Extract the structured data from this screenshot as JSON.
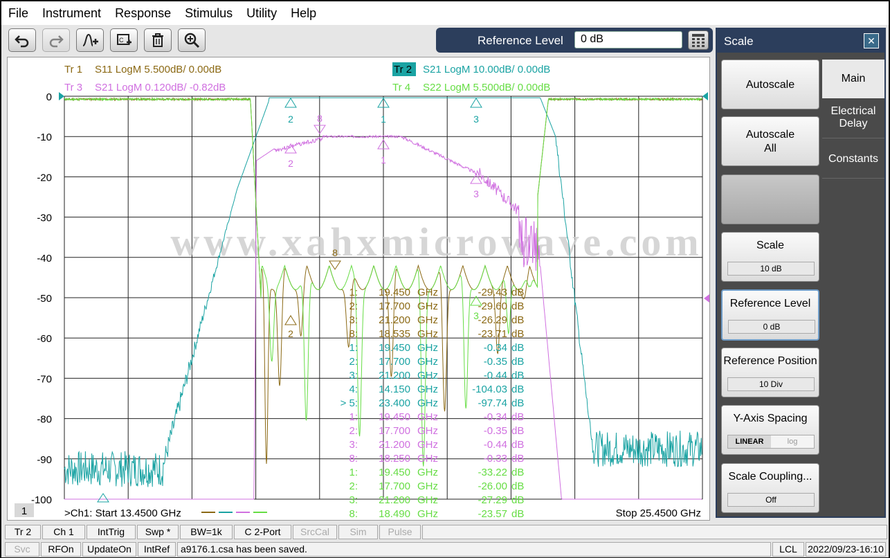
{
  "menu": [
    "File",
    "Instrument",
    "Response",
    "Stimulus",
    "Utility",
    "Help"
  ],
  "toolbar": {
    "buttons": [
      "undo-icon",
      "redo-icon",
      "add-marker-icon",
      "add-trace-icon",
      "delete-icon",
      "zoom-icon"
    ]
  },
  "reference_level": {
    "label": "Reference Level",
    "value": "0 dB"
  },
  "panel": {
    "title": "Scale",
    "close": "✕",
    "buttons": {
      "autoscale": "Autoscale",
      "autoscale_all_line1": "Autoscale",
      "autoscale_all_line2": "All",
      "scale": "Scale",
      "scale_value": "10 dB",
      "reference_level": "Reference Level",
      "reference_level_value": "0 dB",
      "reference_position": "Reference Position",
      "reference_position_value": "10 Div",
      "y_axis_spacing": "Y-Axis Spacing",
      "y_linear": "LINEAR",
      "y_log": "log",
      "scale_coupling": "Scale Coupling...",
      "scale_coupling_value": "Off"
    },
    "tabs": {
      "main": "Main",
      "electrical_delay_1": "Electrical",
      "electrical_delay_2": "Delay",
      "constants": "Constants"
    }
  },
  "traces": [
    {
      "id": "Tr  1",
      "text": "S11 LogM 5.500dB/  0.00dB",
      "color": "#8b6914"
    },
    {
      "id": "Tr  2",
      "text": "S21 LogM 10.00dB/  0.00dB",
      "color": "#1aa3a3"
    },
    {
      "id": "Tr  3",
      "text": "S21 LogM 0.120dB/  -0.82dB",
      "color": "#d070e0"
    },
    {
      "id": "Tr  4",
      "text": "S22 LogM 5.500dB/  0.00dB",
      "color": "#66dd44"
    }
  ],
  "y_ticks": [
    "0",
    "-10",
    "-20",
    "-30",
    "-40",
    "-50",
    "-60",
    "-70",
    "-80",
    "-90",
    "-100"
  ],
  "marker_table": [
    {
      "n": "1:",
      "f": "19.450",
      "u": "GHz",
      "v": "-29.43",
      "d": "dB",
      "color": "#8b6914"
    },
    {
      "n": "2:",
      "f": "17.700",
      "u": "GHz",
      "v": "-29.60",
      "d": "dB",
      "color": "#8b6914"
    },
    {
      "n": "3:",
      "f": "21.200",
      "u": "GHz",
      "v": "-26.29",
      "d": "dB",
      "color": "#8b6914"
    },
    {
      "n": "8:",
      "f": "18.535",
      "u": "GHz",
      "v": "-23.71",
      "d": "dB",
      "color": "#8b6914"
    },
    {
      "n": "1:",
      "f": "19.450",
      "u": "GHz",
      "v": "-0.34",
      "d": "dB",
      "color": "#1aa3a3"
    },
    {
      "n": "2:",
      "f": "17.700",
      "u": "GHz",
      "v": "-0.35",
      "d": "dB",
      "color": "#1aa3a3"
    },
    {
      "n": "3:",
      "f": "21.200",
      "u": "GHz",
      "v": "-0.44",
      "d": "dB",
      "color": "#1aa3a3"
    },
    {
      "n": "4:",
      "f": "14.150",
      "u": "GHz",
      "v": "-104.03",
      "d": "dB",
      "color": "#1aa3a3"
    },
    {
      "n": "> 5:",
      "f": "23.400",
      "u": "GHz",
      "v": "-97.74",
      "d": "dB",
      "color": "#1aa3a3"
    },
    {
      "n": "1:",
      "f": "19.450",
      "u": "GHz",
      "v": "-0.34",
      "d": "dB",
      "color": "#d070e0"
    },
    {
      "n": "2:",
      "f": "17.700",
      "u": "GHz",
      "v": "-0.35",
      "d": "dB",
      "color": "#d070e0"
    },
    {
      "n": "3:",
      "f": "21.200",
      "u": "GHz",
      "v": "-0.44",
      "d": "dB",
      "color": "#d070e0"
    },
    {
      "n": "8:",
      "f": "18.250",
      "u": "GHz",
      "v": "-0.33",
      "d": "dB",
      "color": "#d070e0"
    },
    {
      "n": "1:",
      "f": "19.450",
      "u": "GHz",
      "v": "-33.22",
      "d": "dB",
      "color": "#66dd44"
    },
    {
      "n": "2:",
      "f": "17.700",
      "u": "GHz",
      "v": "-26.00",
      "d": "dB",
      "color": "#66dd44"
    },
    {
      "n": "3:",
      "f": "21.200",
      "u": "GHz",
      "v": "-27.29",
      "d": "dB",
      "color": "#66dd44"
    },
    {
      "n": "8:",
      "f": "18.490",
      "u": "GHz",
      "v": "-23.57",
      "d": "dB",
      "color": "#66dd44"
    }
  ],
  "plot_footer": {
    "channel_number": "1",
    "start": ">Ch1:  Start  13.4500 GHz",
    "stop": "Stop  25.4500 GHz"
  },
  "watermark": "www.xahxmicrowave.com",
  "status_row1": [
    "Tr 2",
    "Ch 1",
    "IntTrig",
    "Swp *",
    "BW=1k",
    "C  2-Port",
    "SrcCal",
    "Sim",
    "Pulse"
  ],
  "status_row1_dim": [
    false,
    false,
    false,
    false,
    false,
    false,
    true,
    true,
    true
  ],
  "status_row2": [
    "Svc",
    "RFOn",
    "UpdateOn",
    "IntRef",
    "a9176.1.csa has been saved.",
    "LCL",
    "2022/09/23-16:10"
  ],
  "status_row2_dim": [
    true,
    false,
    false,
    false,
    false,
    false,
    false
  ]
}
